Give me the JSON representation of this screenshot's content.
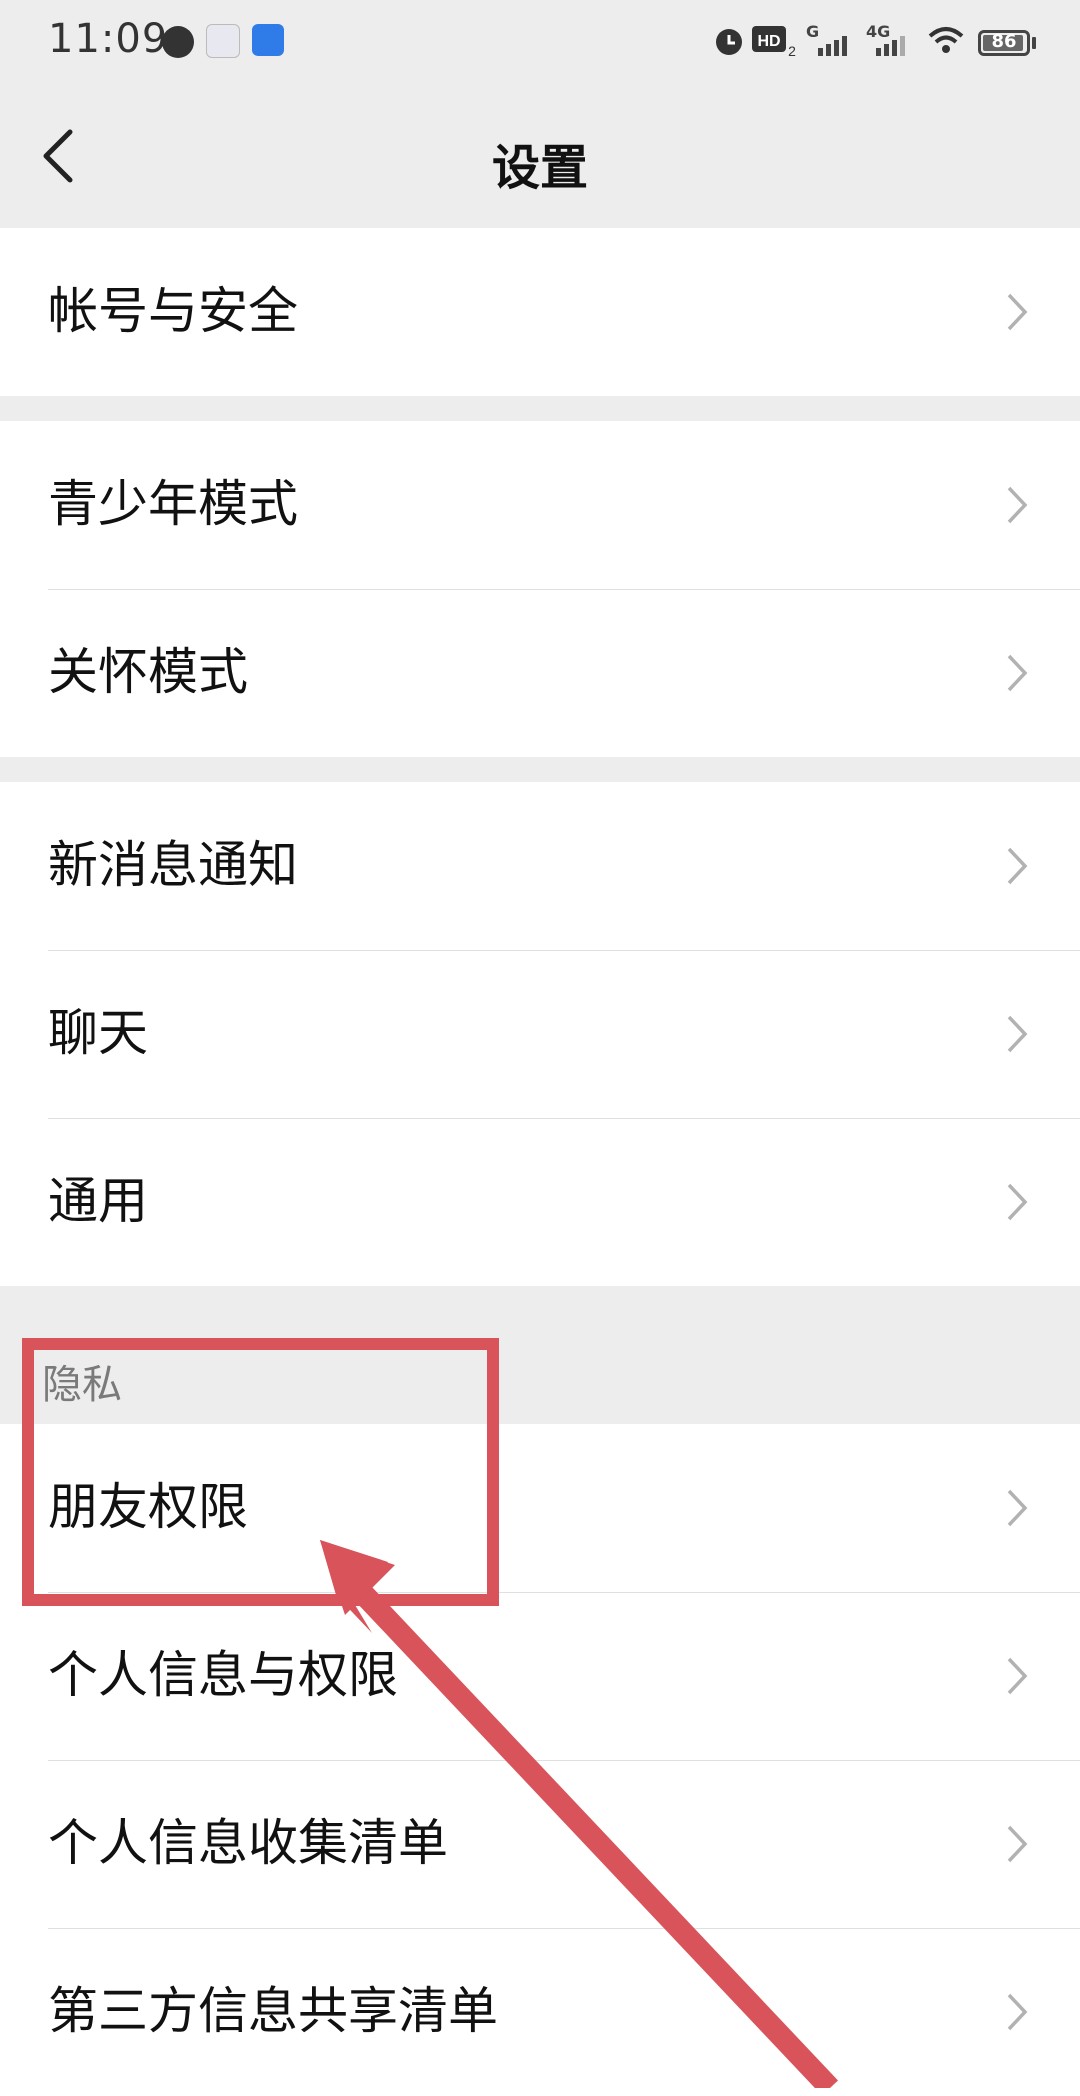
{
  "status_bar": {
    "time": "11:09",
    "network_g": "G",
    "network_4g": "4G",
    "battery": "86",
    "icons": [
      "speed-icon",
      "app-icon",
      "shield-app-icon",
      "alarm-icon",
      "hd-icon",
      "signal-icon",
      "wifi-icon",
      "battery-icon"
    ]
  },
  "nav": {
    "title": "设置",
    "back_icon": "chevron-left-icon"
  },
  "groups": {
    "account": [
      "帐号与安全"
    ],
    "modes": [
      "青少年模式",
      "关怀模式"
    ],
    "general": [
      "新消息通知",
      "聊天",
      "通用"
    ],
    "privacy_header": "隐私",
    "privacy": [
      "朋友权限",
      "个人信息与权限",
      "个人信息收集清单",
      "第三方信息共享清单"
    ]
  },
  "annotation": {
    "color": "#d9535a"
  }
}
